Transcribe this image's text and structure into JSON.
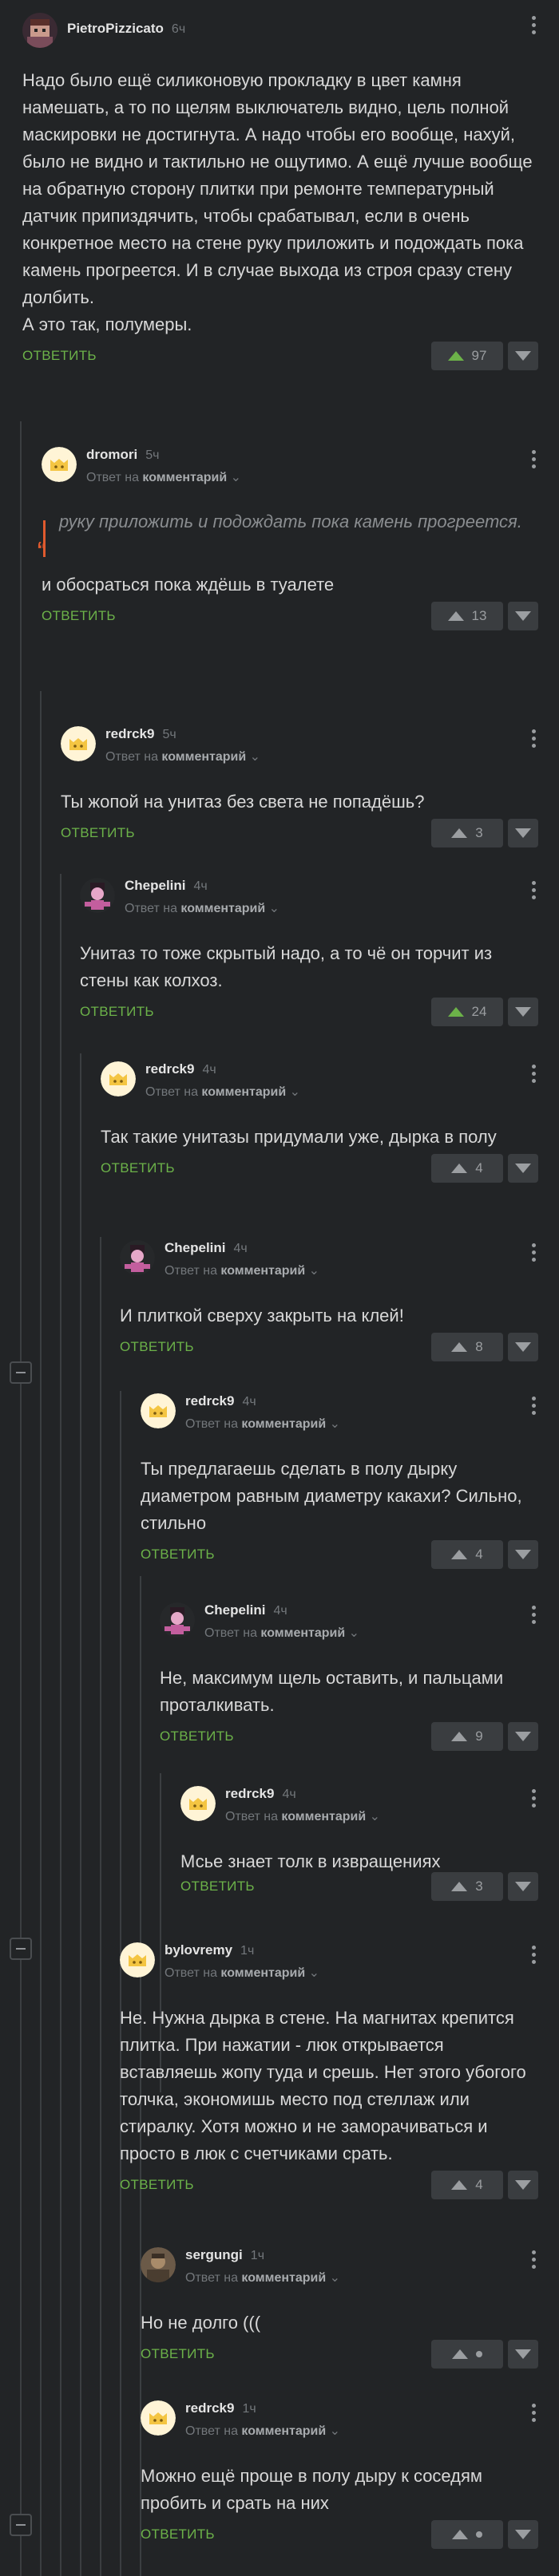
{
  "vote_colors": {
    "positive": "#6cb249",
    "neutral": "#9b9ea1"
  },
  "comments": [
    {
      "author": "PietroPizzicato",
      "time": "6ч",
      "avatar_icon": "pixel-character-avatar",
      "text": "Надо было ещё силиконовую прокладку в цвет камня намешать, а то по щелям выключатель видно, цель полной маскировки не достигнута. А надо чтобы его вообще, нахуй, было не видно и тактильно не ощутимо. А ещё лучше вообще на обратную сторону плитки при ремонте температурный датчик припиздячить, чтобы срабатывал, если в очень конкретное место на стене руку приложить и подождать пока камень прогреется. И в случае выхода из строя сразу стену долбить.\nА это так, полумеры.",
      "reply_label": "ОТВЕТИТЬ",
      "rating": "97"
    },
    {
      "author": "dromori",
      "time": "5ч",
      "avatar_icon": "cat-face-avatar",
      "reply_prefix": "Ответ на",
      "reply_target": "комментарий",
      "quote": "руку приложить и подождать пока камень прогреется.",
      "text": "и обосраться пока ждёшь в туалете",
      "reply_label": "ОТВЕТИТЬ",
      "rating": "13"
    },
    {
      "author": "redrck9",
      "time": "5ч",
      "avatar_icon": "cat-face-avatar",
      "reply_prefix": "Ответ на",
      "reply_target": "комментарий",
      "text": "Ты жопой на унитаз без света не попадёшь?",
      "reply_label": "ОТВЕТИТЬ",
      "rating": "3"
    },
    {
      "author": "Chepelini",
      "time": "4ч",
      "avatar_icon": "pink-character-avatar",
      "reply_prefix": "Ответ на",
      "reply_target": "комментарий",
      "text": "Унитаз то тоже скрытый надо, а то чё он торчит из стены как колхоз.",
      "reply_label": "ОТВЕТИТЬ",
      "rating": "24"
    },
    {
      "author": "redrck9",
      "time": "4ч",
      "avatar_icon": "cat-face-avatar",
      "reply_prefix": "Ответ на",
      "reply_target": "комментарий",
      "text": "Так такие унитазы придумали уже, дырка в полу",
      "reply_label": "ОТВЕТИТЬ",
      "rating": "4"
    },
    {
      "author": "Chepelini",
      "time": "4ч",
      "avatar_icon": "pink-character-avatar",
      "reply_prefix": "Ответ на",
      "reply_target": "комментарий",
      "text": "И плиткой сверху закрыть на клей!",
      "reply_label": "ОТВЕТИТЬ",
      "rating": "8"
    },
    {
      "author": "redrck9",
      "time": "4ч",
      "avatar_icon": "cat-face-avatar",
      "reply_prefix": "Ответ на",
      "reply_target": "комментарий",
      "text": "Ты предлагаешь сделать в полу дырку диаметром равным диаметру какахи? Сильно, стильно",
      "reply_label": "ОТВЕТИТЬ",
      "rating": "4"
    },
    {
      "author": "Chepelini",
      "time": "4ч",
      "avatar_icon": "pink-character-avatar",
      "reply_prefix": "Ответ на",
      "reply_target": "комментарий",
      "text": "Не, максимум щель оставить, и пальцами проталкивать.",
      "reply_label": "ОТВЕТИТЬ",
      "rating": "9"
    },
    {
      "author": "redrck9",
      "time": "4ч",
      "avatar_icon": "cat-face-avatar",
      "reply_prefix": "Ответ на",
      "reply_target": "комментарий",
      "text": "Мсье знает толк в извращениях",
      "reply_label": "ОТВЕТИТЬ",
      "rating": "3"
    },
    {
      "author": "bylovremy",
      "time": "1ч",
      "avatar_icon": "cat-face-avatar",
      "reply_prefix": "Ответ на",
      "reply_target": "комментарий",
      "text": "Не. Нужна дырка в стене. На магнитах крепится плитка. При нажатии - люк открывается вставляешь жопу туда и срешь. Нет этого убогого толчка, экономишь место под стеллаж или стиралку. Хотя можно и не заморачиваться и просто в люк с счетчиками срать.",
      "reply_label": "ОТВЕТИТЬ",
      "rating": "4"
    },
    {
      "author": "sergungi",
      "time": "1ч",
      "avatar_icon": "photo-avatar",
      "reply_prefix": "Ответ на",
      "reply_target": "комментарий",
      "text": "Но не долго (((",
      "reply_label": "ОТВЕТИТЬ",
      "rating": ""
    },
    {
      "author": "redrck9",
      "time": "1ч",
      "avatar_icon": "cat-face-avatar",
      "reply_prefix": "Ответ на",
      "reply_target": "комментарий",
      "text": "Можно ещё проще в полу дыру к соседям пробить и срать на них",
      "reply_label": "ОТВЕТИТЬ",
      "rating": ""
    }
  ]
}
